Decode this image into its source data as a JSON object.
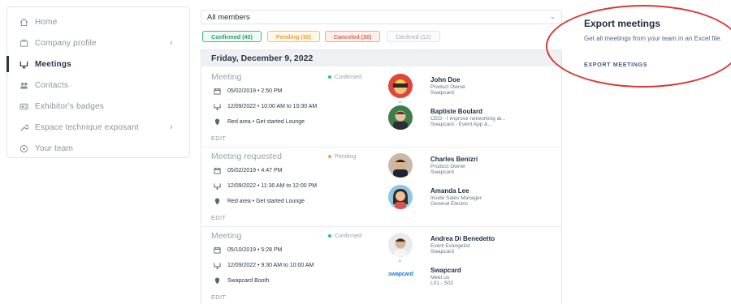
{
  "sidebar": {
    "items": [
      {
        "label": "Home",
        "icon": "home-icon",
        "active": false,
        "chevron": false
      },
      {
        "label": "Company profile",
        "icon": "company-icon",
        "active": false,
        "chevron": true
      },
      {
        "label": "Meetings",
        "icon": "meetings-icon",
        "active": true,
        "chevron": false
      },
      {
        "label": "Contacts",
        "icon": "contacts-icon",
        "active": false,
        "chevron": false
      },
      {
        "label": "Exhibitor's badges",
        "icon": "badge-icon",
        "active": false,
        "chevron": false
      },
      {
        "label": "Espace technique exposant",
        "icon": "tools-icon",
        "active": false,
        "chevron": true
      },
      {
        "label": "Your team",
        "icon": "team-icon",
        "active": false,
        "chevron": false
      }
    ]
  },
  "filter": {
    "selected": "All members"
  },
  "chips": {
    "confirmed": "Confirmed (40)",
    "pending": "Pending (30)",
    "canceled": "Canceled (30)",
    "declined": "Declined (12)"
  },
  "day_header": "Friday, December 9, 2022",
  "meetings": [
    {
      "title": "Meeting",
      "status": "Confirmed",
      "status_color": "#2fbf78",
      "created": "05/02/2019 • 2:50 PM",
      "slot": "12/09/2022 • 10:00 AM to 10:30 AM",
      "location": "Red area • Get started Lounge",
      "edit": "EDIT",
      "people": [
        {
          "name": "John Doe",
          "line1": "Product Owner",
          "line2": "Swapcard"
        },
        {
          "name": "Baptiste Boulard",
          "line1": "CEO - I improve networking at...",
          "line2": "Swapcard - Event App &..."
        }
      ]
    },
    {
      "title": "Meeting requested",
      "status": "Pending",
      "status_color": "#f0a53a",
      "created": "05/02/2019 • 4:47 PM",
      "slot": "12/09/2022 • 11:30 AM to 12:00 PM",
      "location": "Red area • Get started Lounge",
      "edit": "EDIT",
      "people": [
        {
          "name": "Charles Benizri",
          "line1": "Product Owner",
          "line2": "Swapcard"
        },
        {
          "name": "Amanda Lee",
          "line1": "Inside Sales Manager",
          "line2": "General Electric"
        }
      ]
    },
    {
      "title": "Meeting",
      "status": "Confirmed",
      "status_color": "#2fbf78",
      "created": "05/10/2019 • 5:28 PM",
      "slot": "12/09/2022 • 9:30 AM to 10:00 AM",
      "location": "Swapcard Booth",
      "edit": "EDIT",
      "people": [
        {
          "name": "Andrea Di Benedetto",
          "line1": "Event Evangelist",
          "line2": "Swapcard"
        },
        {
          "name": "Swapcard",
          "line1": "Meet us",
          "line2": "L01 - S02"
        }
      ],
      "logo_text": "swapcard"
    }
  ],
  "export": {
    "title": "Export meetings",
    "description": "Get all meetings from your team in an Excel file.",
    "link": "EXPORT MEETINGS",
    "highlight_color": "#d83a33"
  }
}
